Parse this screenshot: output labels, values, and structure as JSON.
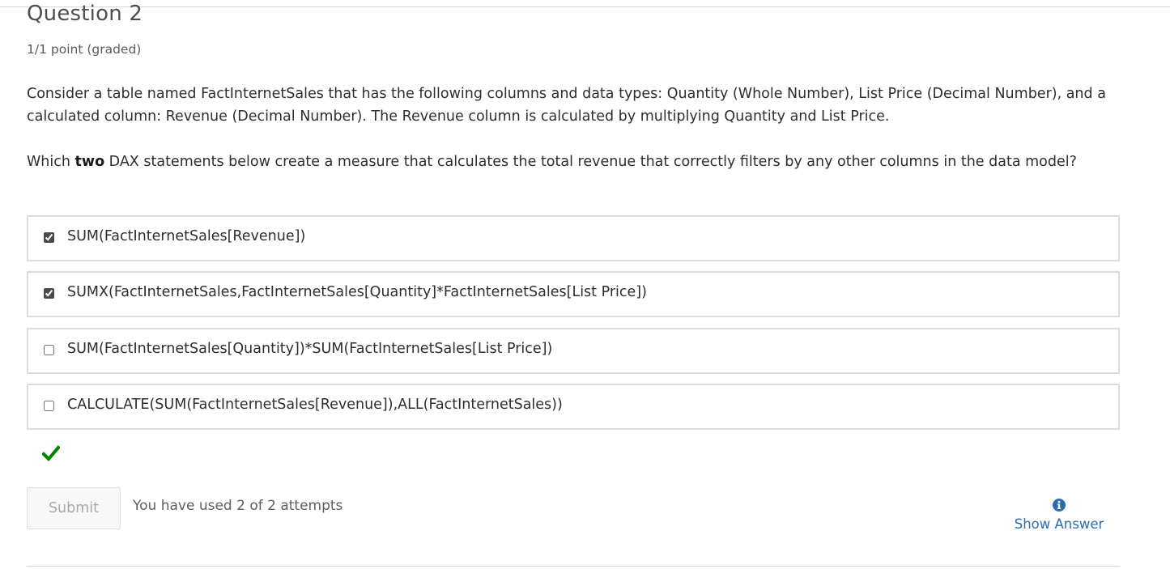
{
  "question": {
    "title": "Question 2",
    "points": "1/1 point (graded)",
    "text": "Consider a table named FactInternetSales that has the following columns and data types: Quantity (Whole Number), List Price (Decimal Number), and a calculated column: Revenue (Decimal Number). The Revenue column is calculated by multiplying Quantity and List Price.",
    "ask_pre": "Which ",
    "ask_bold": "two",
    "ask_post": " DAX statements below create a measure that calculates the total revenue that correctly filters by any other columns in the data model?"
  },
  "choices": [
    {
      "label": "SUM(FactInternetSales[Revenue])",
      "checked": true
    },
    {
      "label": "SUMX(FactInternetSales,FactInternetSales[Quantity]*FactInternetSales[List Price])",
      "checked": true
    },
    {
      "label": "SUM(FactInternetSales[Quantity])*SUM(FactInternetSales[List Price])",
      "checked": false
    },
    {
      "label": "CALCULATE(SUM(FactInternetSales[Revenue]),ALL(FactInternetSales))",
      "checked": false
    }
  ],
  "status": {
    "icon": "correct-checkmark-icon",
    "color": "#008100"
  },
  "actions": {
    "submit_label": "Submit",
    "attempts_text": "You have used 2 of 2 attempts",
    "show_answer_label": "Show Answer",
    "show_answer_icon": "info-circle-icon",
    "link_color": "#2a6db0"
  }
}
